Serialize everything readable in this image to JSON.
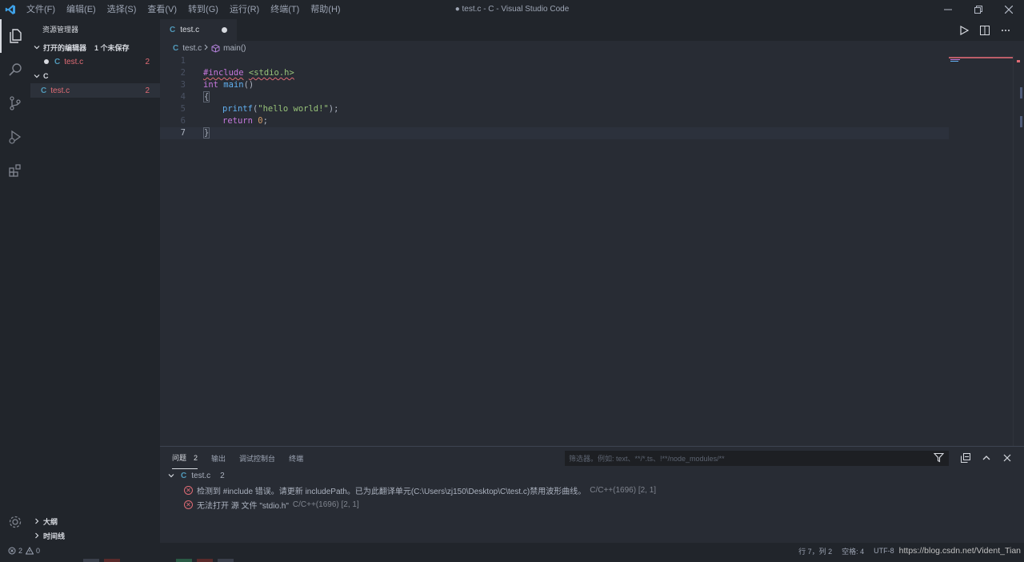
{
  "window": {
    "title": "● test.c - C - Visual Studio Code",
    "menu": [
      "文件(F)",
      "编辑(E)",
      "选择(S)",
      "查看(V)",
      "转到(G)",
      "运行(R)",
      "终端(T)",
      "帮助(H)"
    ]
  },
  "sidebar": {
    "title": "资源管理器",
    "open_editors": {
      "label": "打开的编辑器",
      "badge": "1 个未保存",
      "file": "test.c",
      "problems": "2"
    },
    "folder": {
      "label": "C",
      "file": "test.c",
      "problems": "2"
    },
    "outline": "大纲",
    "timeline": "时间线"
  },
  "editor": {
    "tab": {
      "label": "test.c"
    },
    "breadcrumb": {
      "file": "test.c",
      "symbol": "main()"
    },
    "line_numbers": [
      "1",
      "2",
      "3",
      "4",
      "5",
      "6",
      "7"
    ],
    "code": {
      "include_kw": "#include",
      "include_path": "<stdio.h>",
      "int_kw": "int",
      "main_fn": "main",
      "main_parens": "()",
      "open_brace": "{",
      "printf_fn": "printf",
      "printf_open": "(",
      "printf_str": "\"hello world!\"",
      "printf_close": ");",
      "return_kw": "return",
      "return_val": "0",
      "return_semi": ";",
      "close_brace": "}"
    }
  },
  "panel": {
    "tabs": [
      {
        "label": "问题",
        "badge": "2"
      },
      {
        "label": "输出"
      },
      {
        "label": "调试控制台"
      },
      {
        "label": "终端"
      }
    ],
    "filter_placeholder": "筛选器。例如: text、**/*.ts、!**/node_modules/**",
    "file": {
      "name": "test.c",
      "count": "2"
    },
    "problems": [
      {
        "message": "检测到 #include 错误。请更新 includePath。已为此翻译单元(C:\\Users\\zj150\\Desktop\\C\\test.c)禁用波形曲线。",
        "source": "C/C++(1696)  [2, 1]"
      },
      {
        "message": "无法打开 源 文件 \"stdio.h\"",
        "source": "C/C++(1696)  [2, 1]"
      }
    ]
  },
  "status": {
    "errors": "2",
    "warnings": "0",
    "position": "行 7，列 2",
    "spaces": "空格: 4",
    "encoding": "UTF-8",
    "watermark": "https://blog.csdn.net/Vident_Tian"
  },
  "colors": {
    "accent_c_icon": "#519aba",
    "error": "#e06c75",
    "keyword": "#c678dd",
    "function": "#61afef",
    "string": "#98c379",
    "number": "#d19a66"
  }
}
